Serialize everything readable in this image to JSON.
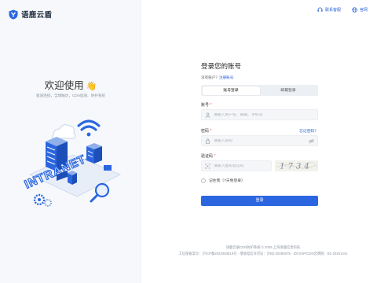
{
  "brand": {
    "name": "语鹿云盾"
  },
  "left": {
    "welcome": "欢迎使用",
    "subtitle": "极速连接，全球触达，CDN加速、防护系统",
    "illustration_text": "INTRANET"
  },
  "topnav": {
    "support": "联系客服",
    "website": "官网"
  },
  "form": {
    "title": "登录您的账号",
    "no_account": "没有账户？",
    "register": "注册账号",
    "tabs": [
      {
        "label": "账号登录",
        "active": true
      },
      {
        "label": "邮箱登录",
        "active": false
      }
    ],
    "account": {
      "label": "账号",
      "required": "*",
      "placeholder": "请输入用户名、邮箱、手机号"
    },
    "password": {
      "label": "密码",
      "required": "*",
      "placeholder": "请输入密码",
      "forgot": "忘记密码？"
    },
    "captcha": {
      "label": "验证码",
      "required": "*",
      "placeholder": "请输入图形验证码",
      "image_text": "1734"
    },
    "remember": "记住我（7天免登录）",
    "submit": "登录"
  },
  "footer": {
    "line1": "语鹿云盾CDN防护系统 © 2025 上海语鹿信息科技",
    "line2": "工信部备案号：沪ICP备2024053519号 · 增值电信许可证：沪B2-20250575 · IDC/ISP/CDN云牌照：B1-20251441"
  },
  "colors": {
    "accent": "#2b66e0",
    "required": "#e34d4d",
    "left_bg": "#f6f8fb"
  },
  "icons": [
    "shield-logo-icon",
    "headset-icon",
    "globe-icon",
    "user-icon",
    "lock-icon",
    "eye-off-icon",
    "captcha-icon",
    "hand-wave-icon"
  ]
}
